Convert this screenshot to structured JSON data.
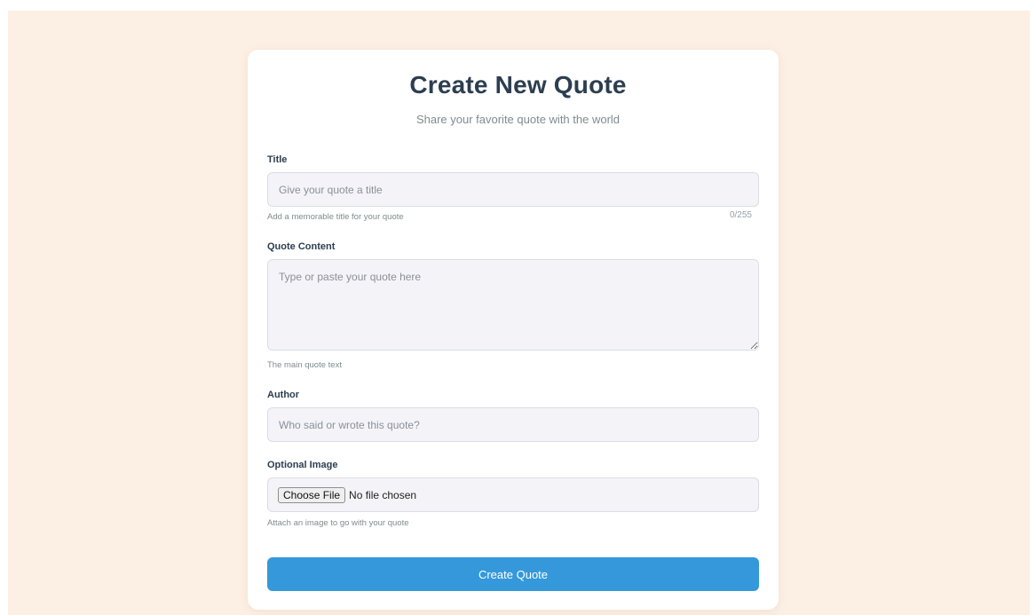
{
  "form": {
    "heading": "Create New Quote",
    "subheading": "Share your favorite quote with the world",
    "title_field": {
      "label": "Title",
      "placeholder": "Give your quote a title",
      "value": "",
      "hint": "Add a memorable title for your quote",
      "counter": "0/255"
    },
    "content_field": {
      "label": "Quote Content",
      "placeholder": "Type or paste your quote here",
      "value": "",
      "hint": "The main quote text"
    },
    "author_field": {
      "label": "Author",
      "placeholder": "Who said or wrote this quote?",
      "value": ""
    },
    "image_field": {
      "label": "Optional Image",
      "button_label": "Choose File",
      "status": "No file chosen",
      "hint": "Attach an image to go with your quote"
    },
    "submit_label": "Create Quote"
  },
  "colors": {
    "page_background": "#fcefe3",
    "card_background": "#ffffff",
    "heading_text": "#2c3e50",
    "accent_button": "#3498db",
    "field_background": "#f4f4f8"
  }
}
